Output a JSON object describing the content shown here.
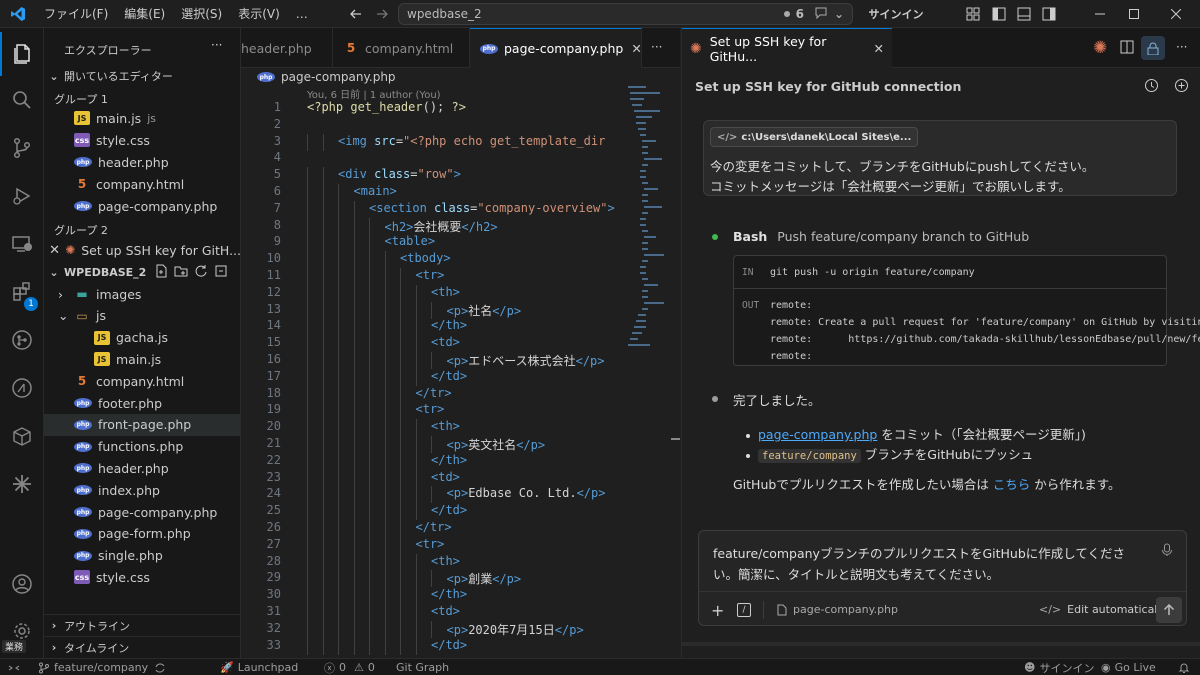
{
  "titlebar": {
    "menus": [
      "ファイル(F)",
      "編集(E)",
      "選択(S)",
      "表示(V)",
      "…"
    ],
    "search_text": "wpedbase_2",
    "badge_count": "6",
    "signin": "サインイン"
  },
  "sidebar": {
    "title": "エクスプローラー",
    "open_editors_label": "開いているエディター",
    "group1_label": "グループ 1",
    "group1_files": [
      {
        "name": "main.js",
        "suffix": "js",
        "type": "js"
      },
      {
        "name": "style.css",
        "suffix": "",
        "type": "css"
      },
      {
        "name": "header.php",
        "suffix": "",
        "type": "php"
      },
      {
        "name": "company.html",
        "suffix": "",
        "type": "html"
      },
      {
        "name": "page-company.php",
        "suffix": "",
        "type": "php"
      }
    ],
    "group2_label": "グループ 2",
    "group2_item": "Set up SSH key for GitH...",
    "project_label": "WPEDBASE_2",
    "tree": [
      {
        "name": "images",
        "type": "folder-closed",
        "indent": 1
      },
      {
        "name": "js",
        "type": "folder-open",
        "indent": 1
      },
      {
        "name": "gacha.js",
        "type": "js",
        "indent": 2
      },
      {
        "name": "main.js",
        "type": "js",
        "indent": 2
      },
      {
        "name": "company.html",
        "type": "html",
        "indent": 1
      },
      {
        "name": "footer.php",
        "type": "php",
        "indent": 1
      },
      {
        "name": "front-page.php",
        "type": "php",
        "indent": 1,
        "selected": true
      },
      {
        "name": "functions.php",
        "type": "php",
        "indent": 1
      },
      {
        "name": "header.php",
        "type": "php",
        "indent": 1
      },
      {
        "name": "index.php",
        "type": "php",
        "indent": 1
      },
      {
        "name": "page-company.php",
        "type": "php",
        "indent": 1
      },
      {
        "name": "page-form.php",
        "type": "php",
        "indent": 1
      },
      {
        "name": "single.php",
        "type": "php",
        "indent": 1
      },
      {
        "name": "style.css",
        "type": "css",
        "indent": 1
      }
    ],
    "outline_label": "アウトライン",
    "timeline_label": "タイムライン"
  },
  "tabs": [
    {
      "label": "header.php",
      "type": "php"
    },
    {
      "label": "company.html",
      "type": "html"
    },
    {
      "label": "page-company.php",
      "type": "php",
      "active": true
    }
  ],
  "editor": {
    "breadcrumb": "page-company.php",
    "blame": "You, 6 日前 | 1 author (You)",
    "lines": [
      {
        "n": "1",
        "indent": 0,
        "parts": [
          [
            "t-php",
            "<?php "
          ],
          [
            "t-php",
            "get_header"
          ],
          [
            "t-txt",
            "(); "
          ],
          [
            "t-php",
            "?>"
          ]
        ]
      },
      {
        "n": "2",
        "indent": 0,
        "parts": []
      },
      {
        "n": "3",
        "indent": 2,
        "parts": [
          [
            "t-tag",
            "<img "
          ],
          [
            "t-attr",
            "src"
          ],
          [
            "t-txt",
            "="
          ],
          [
            "t-str",
            "\"<?php echo get_template_dir"
          ]
        ]
      },
      {
        "n": "4",
        "indent": 0,
        "parts": []
      },
      {
        "n": "5",
        "indent": 2,
        "parts": [
          [
            "t-tag",
            "<div "
          ],
          [
            "t-attr",
            "class"
          ],
          [
            "t-txt",
            "="
          ],
          [
            "t-str",
            "\"row\""
          ],
          [
            "t-tag",
            ">"
          ]
        ]
      },
      {
        "n": "6",
        "indent": 3,
        "parts": [
          [
            "t-tag",
            "<main>"
          ]
        ]
      },
      {
        "n": "7",
        "indent": 4,
        "parts": [
          [
            "t-tag",
            "<section "
          ],
          [
            "t-attr",
            "class"
          ],
          [
            "t-txt",
            "="
          ],
          [
            "t-str",
            "\"company-overview\""
          ],
          [
            "t-tag",
            ">"
          ]
        ]
      },
      {
        "n": "8",
        "indent": 5,
        "parts": [
          [
            "t-tag",
            "<h2>"
          ],
          [
            "t-txt",
            "会社概要"
          ],
          [
            "t-tag",
            "</h2>"
          ]
        ]
      },
      {
        "n": "9",
        "indent": 5,
        "parts": [
          [
            "t-tag",
            "<table>"
          ]
        ]
      },
      {
        "n": "10",
        "indent": 6,
        "parts": [
          [
            "t-tag",
            "<tbody>"
          ]
        ]
      },
      {
        "n": "11",
        "indent": 7,
        "parts": [
          [
            "t-tag",
            "<tr>"
          ]
        ]
      },
      {
        "n": "12",
        "indent": 8,
        "parts": [
          [
            "t-tag",
            "<th>"
          ]
        ]
      },
      {
        "n": "13",
        "indent": 9,
        "parts": [
          [
            "t-tag",
            "<p>"
          ],
          [
            "t-txt",
            "社名"
          ],
          [
            "t-tag",
            "</p>"
          ]
        ]
      },
      {
        "n": "14",
        "indent": 8,
        "parts": [
          [
            "t-tag",
            "</th>"
          ]
        ]
      },
      {
        "n": "15",
        "indent": 8,
        "parts": [
          [
            "t-tag",
            "<td>"
          ]
        ]
      },
      {
        "n": "16",
        "indent": 9,
        "parts": [
          [
            "t-tag",
            "<p>"
          ],
          [
            "t-txt",
            "エドベース株式会社"
          ],
          [
            "t-tag",
            "</p>"
          ]
        ]
      },
      {
        "n": "17",
        "indent": 8,
        "parts": [
          [
            "t-tag",
            "</td>"
          ]
        ]
      },
      {
        "n": "18",
        "indent": 7,
        "parts": [
          [
            "t-tag",
            "</tr>"
          ]
        ]
      },
      {
        "n": "19",
        "indent": 7,
        "parts": [
          [
            "t-tag",
            "<tr>"
          ]
        ]
      },
      {
        "n": "20",
        "indent": 8,
        "parts": [
          [
            "t-tag",
            "<th>"
          ]
        ]
      },
      {
        "n": "21",
        "indent": 9,
        "parts": [
          [
            "t-tag",
            "<p>"
          ],
          [
            "t-txt",
            "英文社名"
          ],
          [
            "t-tag",
            "</p>"
          ]
        ]
      },
      {
        "n": "22",
        "indent": 8,
        "parts": [
          [
            "t-tag",
            "</th>"
          ]
        ]
      },
      {
        "n": "23",
        "indent": 8,
        "parts": [
          [
            "t-tag",
            "<td>"
          ]
        ]
      },
      {
        "n": "24",
        "indent": 9,
        "parts": [
          [
            "t-tag",
            "<p>"
          ],
          [
            "t-txt",
            "Edbase Co. Ltd."
          ],
          [
            "t-tag",
            "</p>"
          ]
        ]
      },
      {
        "n": "25",
        "indent": 8,
        "parts": [
          [
            "t-tag",
            "</td>"
          ]
        ]
      },
      {
        "n": "26",
        "indent": 7,
        "parts": [
          [
            "t-tag",
            "</tr>"
          ]
        ]
      },
      {
        "n": "27",
        "indent": 7,
        "parts": [
          [
            "t-tag",
            "<tr>"
          ]
        ]
      },
      {
        "n": "28",
        "indent": 8,
        "parts": [
          [
            "t-tag",
            "<th>"
          ]
        ]
      },
      {
        "n": "29",
        "indent": 9,
        "parts": [
          [
            "t-tag",
            "<p>"
          ],
          [
            "t-txt",
            "創業"
          ],
          [
            "t-tag",
            "</p>"
          ]
        ]
      },
      {
        "n": "30",
        "indent": 8,
        "parts": [
          [
            "t-tag",
            "</th>"
          ]
        ]
      },
      {
        "n": "31",
        "indent": 8,
        "parts": [
          [
            "t-tag",
            "<td>"
          ]
        ]
      },
      {
        "n": "32",
        "indent": 9,
        "parts": [
          [
            "t-tag",
            "<p>"
          ],
          [
            "t-txt",
            "2020年7月15日"
          ],
          [
            "t-tag",
            "</p>"
          ]
        ]
      },
      {
        "n": "33",
        "indent": 8,
        "parts": [
          [
            "t-tag",
            "</td>"
          ]
        ]
      }
    ]
  },
  "chat": {
    "tab_label": "Set up SSH key for GitHu...",
    "title": "Set up SSH key for GitHub connection",
    "user_message": {
      "path_chip": "c:\\Users\\danek\\Local Sites\\e...",
      "lines": [
        "今の変更をコミットして、ブランチをGitHubにpushしてください。",
        "コミットメッセージは「会社概要ページ更新」でお願いします。"
      ]
    },
    "bash": {
      "label": "Bash",
      "description": "Push feature/company branch to GitHub",
      "in_label": "IN",
      "in_command": "git push -u origin feature/company",
      "out_label": "OUT",
      "out_lines": [
        "remote:",
        "remote: Create a pull request for 'feature/company' on GitHub by visitin",
        "remote:      https://github.com/takada-skillhub/lessonEdbase/pull/new/fe",
        "remote:"
      ]
    },
    "done": "完了しました。",
    "bullets": [
      {
        "link": "page-company.php",
        "text": " をコミット（「会社概要ページ更新」)"
      },
      {
        "code": "feature/company",
        "text": " ブランチをGitHubにプッシュ"
      }
    ],
    "pr_text_before": "GitHubでプルリクエストを作成したい場合は ",
    "pr_link": "こちら",
    "pr_text_after": " から作れます。",
    "input": {
      "lines": [
        "feature/companyブランチのプルリクエストをGitHubに作成してくださ",
        "い。簡潔に、タイトルと説明文も考えてください。"
      ],
      "file_chip": "page-company.php",
      "edit_mode": "Edit automatically"
    }
  },
  "statusbar": {
    "branch": "feature/company",
    "launchpad": "Launchpad",
    "errors": "0",
    "warnings": "0",
    "git_graph": "Git Graph",
    "signin": "サインイン",
    "golive": "Go Live"
  },
  "colors": {
    "accent": "#0078d4",
    "badge": "#0078d4",
    "claude": "#d97757"
  }
}
